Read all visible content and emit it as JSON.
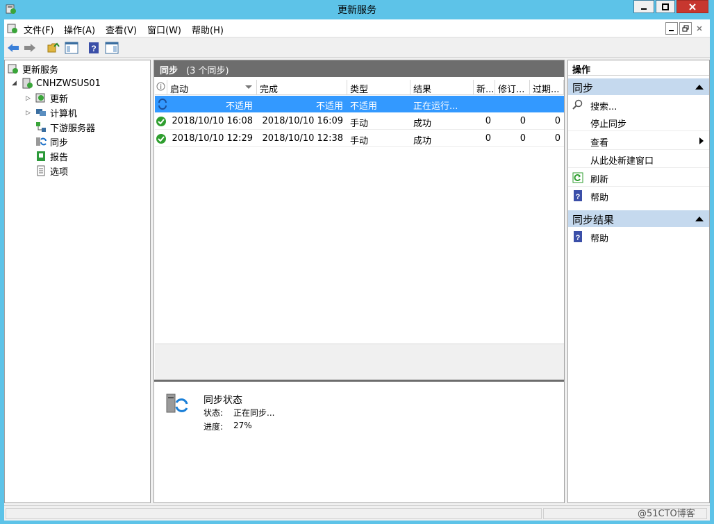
{
  "window": {
    "title": "更新服务"
  },
  "menu": [
    "文件(F)",
    "操作(A)",
    "查看(V)",
    "窗口(W)",
    "帮助(H)"
  ],
  "tree": {
    "root": "更新服务",
    "server": "CNHZWSUS01",
    "children": [
      "更新",
      "计算机",
      "下游服务器",
      "同步",
      "报告",
      "选项"
    ]
  },
  "center": {
    "title": "同步",
    "subtitle": "(3 个同步)",
    "columns": [
      "",
      "启动",
      "完成",
      "类型",
      "结果",
      "新...",
      "修订...",
      "过期..."
    ],
    "rows": [
      {
        "start": "不适用",
        "end": "不适用",
        "type": "不适用",
        "result": "正在运行...",
        "new": "",
        "rev": "",
        "exp": ""
      },
      {
        "start": "2018/10/10 16:08",
        "end": "2018/10/10 16:09",
        "type": "手动",
        "result": "成功",
        "new": "0",
        "rev": "0",
        "exp": "0"
      },
      {
        "start": "2018/10/10 12:29",
        "end": "2018/10/10 12:38",
        "type": "手动",
        "result": "成功",
        "new": "0",
        "rev": "0",
        "exp": "0"
      }
    ],
    "detail": {
      "heading": "同步状态",
      "status_label": "状态:",
      "status_value": "正在同步...",
      "progress_label": "进度:",
      "progress_value": "27%"
    }
  },
  "actions": {
    "title": "操作",
    "section1": "同步",
    "section1_items": [
      "搜索...",
      "停止同步",
      "查看",
      "从此处新建窗口",
      "刷新",
      "帮助"
    ],
    "section2": "同步结果",
    "section2_items": [
      "帮助"
    ]
  },
  "watermark": "@51CTO博客",
  "colors": {
    "titlebar": "#5dc3e8",
    "selection": "#3399ff",
    "section": "#c5d9ee",
    "header_bar": "#6d6d6d"
  }
}
